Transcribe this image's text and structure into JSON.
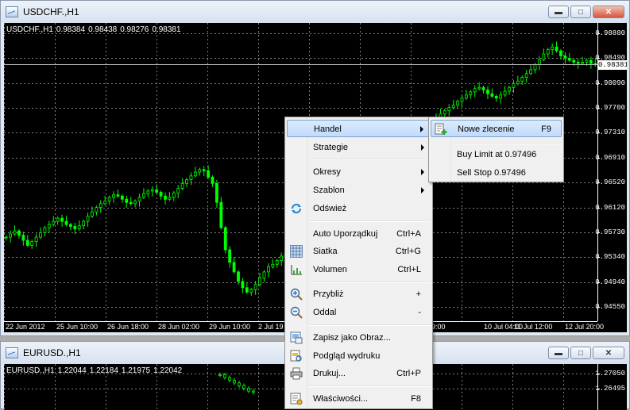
{
  "window1": {
    "title": "USDCHF.,H1",
    "ohlc": {
      "symbol": "USDCHF.,H1",
      "open": "0.98384",
      "high": "0.98438",
      "low": "0.98276",
      "close": "0.98381"
    },
    "current_price": "0.98381",
    "y_ticks": [
      "0.98880",
      "0.98490",
      "0.98090",
      "0.97700",
      "0.97310",
      "0.96910",
      "0.96520",
      "0.96120",
      "0.95730",
      "0.95340",
      "0.94940",
      "0.94550"
    ],
    "x_ticks": [
      "22 Jun 2012",
      "25 Jun 10:00",
      "26 Jun 18:00",
      "28 Jun 02:00",
      "29 Jun 10:00",
      "2 Jul 19",
      "9:00",
      "10 Jul 04:00",
      "11 Jul 12:00",
      "12 Jul 20:00"
    ]
  },
  "window2": {
    "title": "EURUSD.,H1",
    "ohlc": {
      "symbol": "EURUSD.,H1",
      "open": "1.22044",
      "high": "1.22184",
      "low": "1.21975",
      "close": "1.22042"
    },
    "y_ticks": [
      "1.27050",
      "1.26495"
    ]
  },
  "chart_data": [
    {
      "type": "candlestick",
      "title": "USDCHF.,H1",
      "ylim": [
        0.9432,
        0.9904
      ],
      "grid": true,
      "series": [
        {
          "values": [
            0.9565,
            0.957,
            0.9575,
            0.9568,
            0.956,
            0.9552,
            0.9558,
            0.9565,
            0.9572,
            0.958,
            0.9585,
            0.959,
            0.9595,
            0.959,
            0.9585,
            0.9582,
            0.9578,
            0.9583,
            0.959,
            0.9598,
            0.9605,
            0.9612,
            0.9618,
            0.9622,
            0.9628,
            0.9632,
            0.963,
            0.9625,
            0.962,
            0.9618,
            0.9622,
            0.9628,
            0.9634,
            0.9638,
            0.964,
            0.9636,
            0.963,
            0.9625,
            0.9628,
            0.9635,
            0.9642,
            0.965,
            0.9656,
            0.9662,
            0.9668,
            0.9672,
            0.967,
            0.966,
            0.965,
            0.962,
            0.958,
            0.9545,
            0.9525,
            0.951,
            0.9495,
            0.9485,
            0.9478,
            0.9482,
            0.949,
            0.95,
            0.951,
            0.9518,
            0.9522,
            0.9528,
            0.9535,
            0.954,
            0.9545,
            0.9548,
            0.955,
            0.9546,
            0.954,
            0.9536,
            0.9538,
            0.9545,
            0.9552,
            0.956,
            0.957,
            0.9585,
            0.96,
            0.9615,
            0.963,
            0.9645,
            0.966,
            0.9675,
            0.969,
            0.9705,
            0.9718,
            0.9728,
            0.9735,
            0.9738,
            0.9732,
            0.9726,
            0.972,
            0.9714,
            0.9712,
            0.9718,
            0.9725,
            0.9732,
            0.974,
            0.9748,
            0.9755,
            0.976,
            0.9765,
            0.977,
            0.9774,
            0.978,
            0.9785,
            0.979,
            0.9795,
            0.98,
            0.9802,
            0.9798,
            0.9792,
            0.9788,
            0.9785,
            0.979,
            0.9796,
            0.9802,
            0.9808,
            0.9812,
            0.9818,
            0.9824,
            0.983,
            0.9838,
            0.9846,
            0.9855,
            0.9862,
            0.9866,
            0.986,
            0.9852,
            0.9848,
            0.9845,
            0.9842,
            0.984,
            0.9842,
            0.9845,
            0.984,
            0.9838
          ]
        }
      ]
    },
    {
      "type": "candlestick",
      "title": "EURUSD.,H1",
      "ylim": [
        1.257,
        1.274
      ],
      "grid": true,
      "series": [
        {
          "values": [
            1.27,
            1.269,
            1.268,
            1.267,
            1.266,
            1.265,
            1.264,
            1.2635
          ]
        }
      ]
    }
  ],
  "context_menu": {
    "items": [
      {
        "label": "Handel",
        "shortcut": "",
        "submenu": true,
        "icon": ""
      },
      {
        "label": "Strategie",
        "shortcut": "",
        "submenu": true,
        "icon": ""
      },
      {
        "label": "Okresy",
        "shortcut": "",
        "submenu": true,
        "icon": ""
      },
      {
        "label": "Szablon",
        "shortcut": "",
        "submenu": true,
        "icon": ""
      },
      {
        "label": "Odśwież",
        "shortcut": "",
        "submenu": false,
        "icon": "refresh-icon"
      },
      {
        "label": "Auto Uporządkuj",
        "shortcut": "Ctrl+A",
        "submenu": false,
        "icon": ""
      },
      {
        "label": "Siatka",
        "shortcut": "Ctrl+G",
        "submenu": false,
        "icon": "grid-icon"
      },
      {
        "label": "Volumen",
        "shortcut": "Ctrl+L",
        "submenu": false,
        "icon": "volume-icon"
      },
      {
        "label": "Przybliż",
        "shortcut": "+",
        "submenu": false,
        "icon": "zoom-in-icon"
      },
      {
        "label": "Oddal",
        "shortcut": "-",
        "submenu": false,
        "icon": "zoom-out-icon"
      },
      {
        "label": "Zapisz jako Obraz...",
        "shortcut": "",
        "submenu": false,
        "icon": "save-image-icon"
      },
      {
        "label": "Podgląd wydruku",
        "shortcut": "",
        "submenu": false,
        "icon": "print-preview-icon"
      },
      {
        "label": "Drukuj...",
        "shortcut": "Ctrl+P",
        "submenu": false,
        "icon": "print-icon"
      },
      {
        "label": "Właściwości...",
        "shortcut": "F8",
        "submenu": false,
        "icon": "properties-icon"
      }
    ]
  },
  "submenu": {
    "items": [
      {
        "label": "Nowe zlecenie",
        "shortcut": "F9",
        "icon": "new-order-icon"
      },
      {
        "label": "Buy Limit at 0.97496",
        "shortcut": ""
      },
      {
        "label": "Sell Stop 0.97496",
        "shortcut": ""
      }
    ]
  },
  "colors": {
    "candle": "#00ff00",
    "background": "#000000",
    "grid": "#808080",
    "foreground": "#ffffff"
  }
}
